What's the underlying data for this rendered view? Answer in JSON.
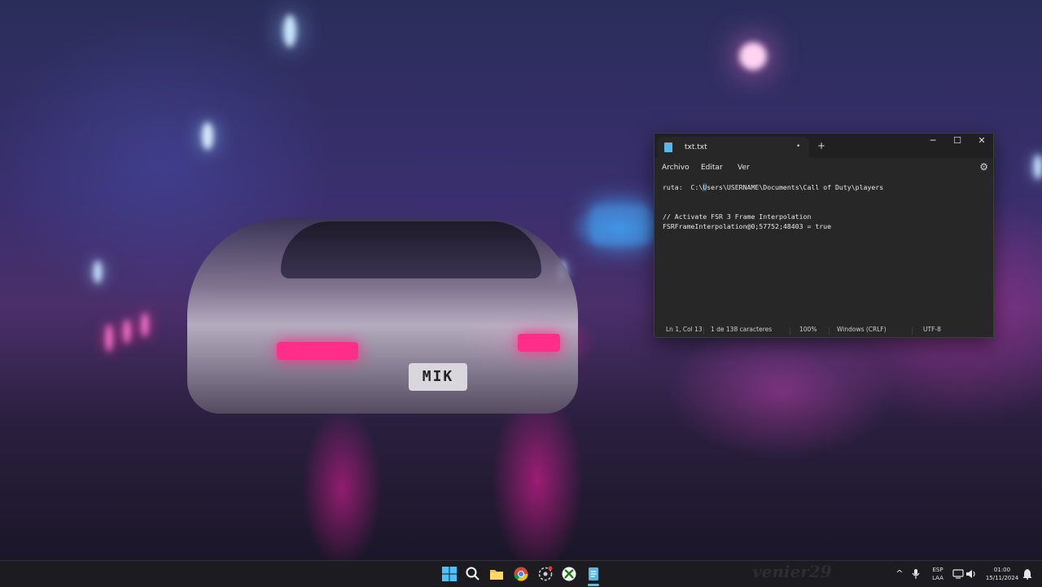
{
  "wallpaper": {
    "plate_text": "MIK",
    "watermark": "venier29"
  },
  "notepad": {
    "tab_title": "txt.txt",
    "tab_modified_dot": "•",
    "new_tab_symbol": "+",
    "window_controls": {
      "minimize": "─",
      "maximize": "☐",
      "close": "✕"
    },
    "menu": [
      "Archivo",
      "Editar",
      "Ver"
    ],
    "settings_icon": "⚙",
    "content": {
      "path_label": "ruta:",
      "path_part1": "C:\\",
      "path_selected": "U",
      "path_part2": "sers\\USERNAME\\Documents\\Call of Duty\\players",
      "comment_line": "// Activate FSR 3 Frame Interpolation",
      "setting_line": "FSRFrameInterpolation@0;57752;48403 = true"
    },
    "status": {
      "position": "Ln 1, Col 13",
      "chars": "1 de 138 caracteres",
      "zoom": "100%",
      "line_ending": "Windows (CRLF)",
      "encoding": "UTF-8"
    },
    "colors": {
      "accent": "#59b6e6",
      "selection": "#264f78"
    }
  },
  "taskbar": {
    "icons": [
      "windows-start-icon",
      "search-icon",
      "file-explorer-icon",
      "chrome-icon",
      "game-icon",
      "xbox-icon",
      "notepad-icon"
    ],
    "tray": {
      "chevron": "^",
      "language": "ESP",
      "layout": "LAA",
      "time": "01:00",
      "date": "15/11/2024"
    }
  }
}
